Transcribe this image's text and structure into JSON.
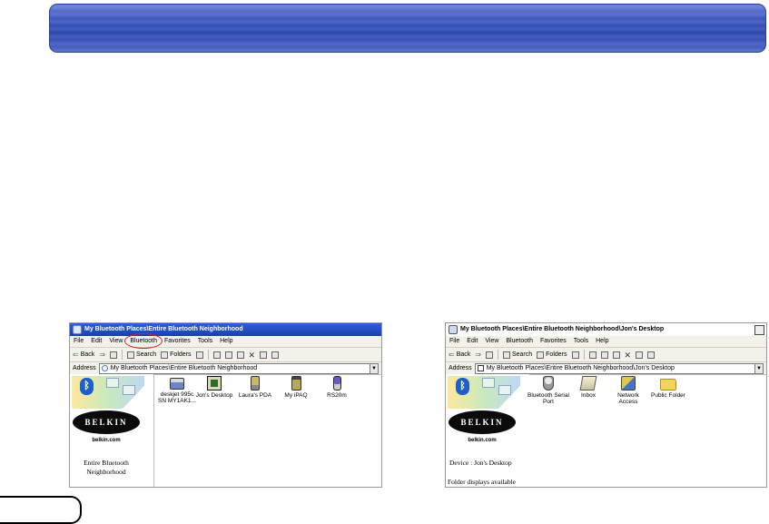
{
  "window1": {
    "title": "My Bluetooth Places\\Entire Bluetooth Neighborhood",
    "menu": [
      "File",
      "Edit",
      "View",
      "Bluetooth",
      "Favorites",
      "Tools",
      "Help"
    ],
    "toolbar": {
      "back": "Back",
      "search": "Search",
      "folders": "Folders"
    },
    "address_label": "Address",
    "address_value": "My Bluetooth Places\\Entire Bluetooth Neighborhood",
    "side": {
      "brand": "BELKIN",
      "url": "belkin.com",
      "title": "Entire Bluetooth Neighborhood"
    },
    "items": [
      {
        "label": "deskjet 995c SN MY1AK1...",
        "icon": "printer-icon"
      },
      {
        "label": "Jon's Desktop",
        "icon": "desktop-computer-icon"
      },
      {
        "label": "Laura's PDA",
        "icon": "pda-icon"
      },
      {
        "label": "My iPAQ",
        "icon": "ipaq-icon"
      },
      {
        "label": "RS20m",
        "icon": "mobile-phone-icon"
      }
    ]
  },
  "window2": {
    "title": "My Bluetooth Places\\Entire Bluetooth Neighborhood\\Jon's Desktop",
    "menu": [
      "File",
      "Edit",
      "View",
      "Bluetooth",
      "Favorites",
      "Tools",
      "Help"
    ],
    "toolbar": {
      "back": "Back",
      "search": "Search",
      "folders": "Folders"
    },
    "address_label": "Address",
    "address_value": "My Bluetooth Places\\Entire Bluetooth Neighborhood\\Jon's Desktop",
    "side": {
      "brand": "BELKIN",
      "url": "belkin.com",
      "device": "Device : Jon's Desktop",
      "folder": "Folder displays available"
    },
    "items": [
      {
        "label": "Bluetooth Serial Port",
        "icon": "serial-port-icon"
      },
      {
        "label": "Inbox",
        "icon": "inbox-icon"
      },
      {
        "label": "Network Access",
        "icon": "network-access-icon"
      },
      {
        "label": "Public Folder",
        "icon": "folder-icon"
      }
    ]
  },
  "colors": {
    "banner": "#3e58bf",
    "highlight_circle": "#d61f1f",
    "titlebar": "#2e5fd6"
  }
}
